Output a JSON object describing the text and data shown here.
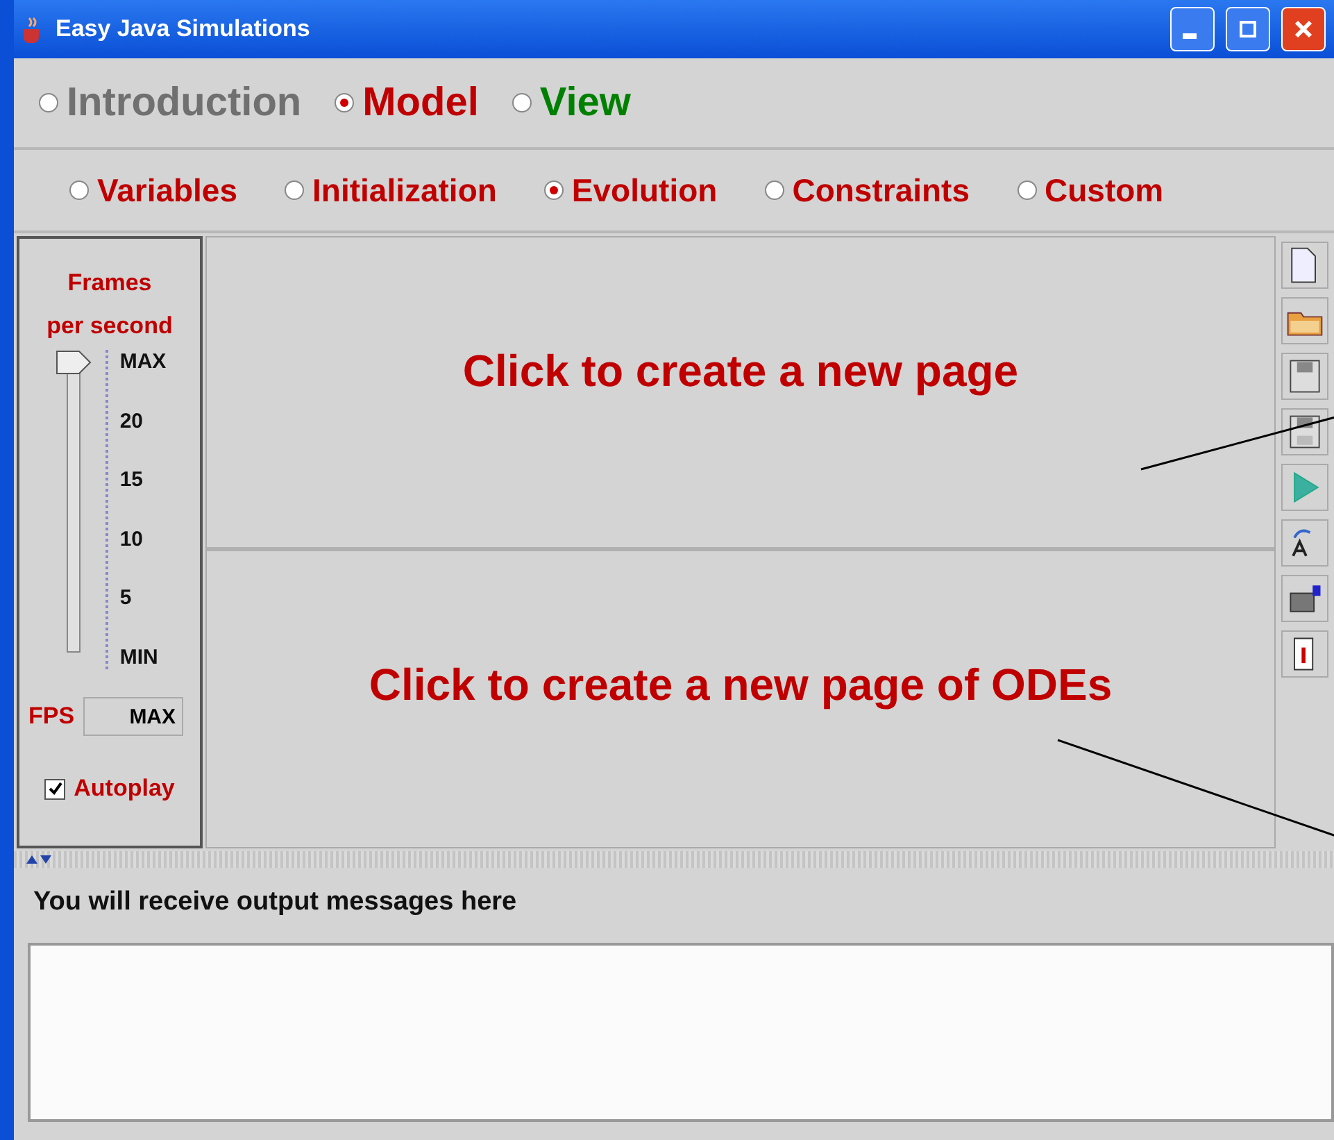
{
  "window": {
    "title": "Easy Java Simulations"
  },
  "main_tabs": [
    {
      "label": "Introduction",
      "selected": false,
      "color": "#707070"
    },
    {
      "label": "Model",
      "selected": true,
      "color": "#c00000"
    },
    {
      "label": "View",
      "selected": false,
      "color": "#008000"
    }
  ],
  "sub_tabs": [
    {
      "label": "Variables",
      "selected": false
    },
    {
      "label": "Initialization",
      "selected": false
    },
    {
      "label": "Evolution",
      "selected": true
    },
    {
      "label": "Constraints",
      "selected": false
    },
    {
      "label": "Custom",
      "selected": false
    }
  ],
  "fps_panel": {
    "title": "Frames",
    "subtitle": "per second",
    "level": 1,
    "ticks": [
      "MAX",
      "20",
      "15",
      "10",
      "5",
      "MIN"
    ],
    "fps_label": "FPS",
    "fps_value": "MAX",
    "autoplay": {
      "label": "Autoplay",
      "checked": true
    }
  },
  "pages": [
    {
      "text": "Click to create a new page"
    },
    {
      "text": "Click to create a new page of ODEs"
    }
  ],
  "output": {
    "label": "You will receive output messages here"
  }
}
